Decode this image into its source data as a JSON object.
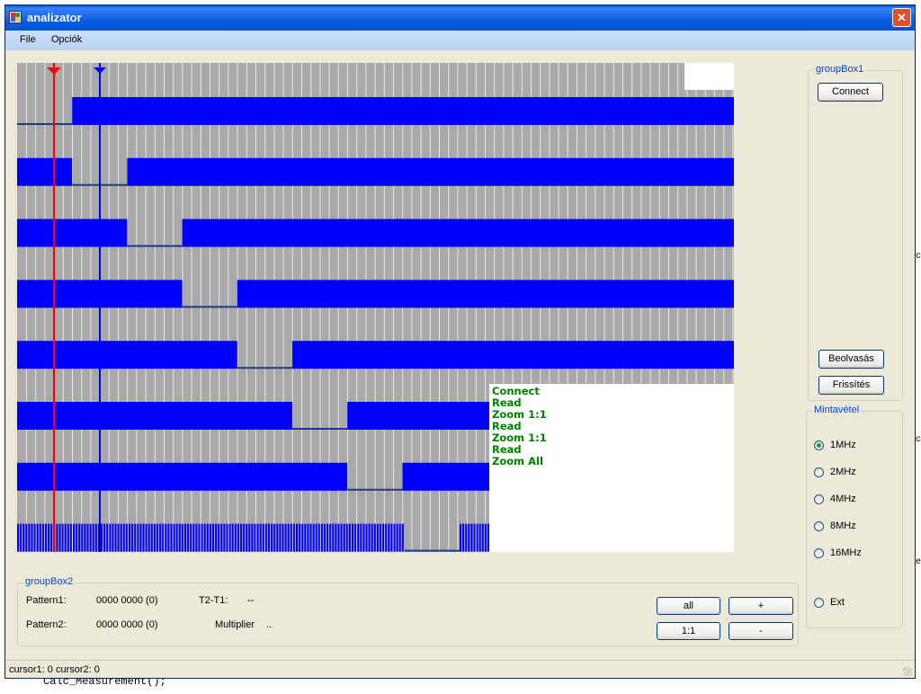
{
  "window": {
    "title": "analizator",
    "close_glyph": "✕"
  },
  "menu": {
    "items": [
      "File",
      "Opciók"
    ]
  },
  "plot": {
    "grid_color": "#a9a9a9",
    "background": "#ffffff",
    "signal_color": "#0000ff",
    "cursor1_color": "#ff0000",
    "cursor2_color": "#0000ff"
  },
  "log": {
    "lines": [
      "Connect",
      "Read",
      "Zoom 1:1",
      "Read",
      "Zoom 1:1",
      "Read",
      "Zoom All"
    ]
  },
  "groupbox1": {
    "title": "groupBox1",
    "connect_label": "Connect",
    "beolvasas_label": "Beolvasás",
    "frissites_label": "Frissítés"
  },
  "mintavetel": {
    "title": "Mintavétel",
    "options": [
      {
        "label": "1MHz",
        "checked": true
      },
      {
        "label": "2MHz",
        "checked": false
      },
      {
        "label": "4MHz",
        "checked": false
      },
      {
        "label": "8MHz",
        "checked": false
      },
      {
        "label": "16MHz",
        "checked": false
      },
      {
        "label": "Ext",
        "checked": false
      }
    ]
  },
  "groupbox2": {
    "title": "groupBox2",
    "pattern1_label": "Pattern1:",
    "pattern1_value": "0000 0000 (0)",
    "pattern2_label": "Pattern2:",
    "pattern2_value": "0000 0000 (0)",
    "t2t1_label": "T2-T1:",
    "t2t1_value": "--",
    "multiplier_label": "Multiplier",
    "multiplier_value": "..",
    "all_label": "all",
    "plus_label": "+",
    "one_label": "1:1",
    "minus_label": "-"
  },
  "status": {
    "text": "cursor1: 0 cursor2: 0"
  },
  "background_code": {
    "text": "Calc_Measurement();"
  }
}
